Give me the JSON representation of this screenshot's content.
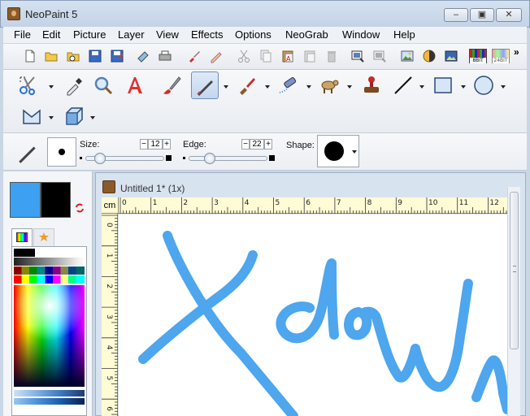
{
  "window": {
    "title": "NeoPaint 5",
    "min_glyph": "–",
    "max_glyph": "▣",
    "close_glyph": "✕"
  },
  "menu": [
    "File",
    "Edit",
    "Picture",
    "Layer",
    "View",
    "Effects",
    "Options",
    "NeoGrab",
    "Window",
    "Help"
  ],
  "toolbar_icons": [
    "new-icon",
    "open-icon",
    "open-recent-icon",
    "save-icon",
    "save-as-icon",
    "scan-icon",
    "print-icon",
    "brush-preset-icon",
    "pencil-preset-icon",
    "cut-icon",
    "copy-icon",
    "paste-icon",
    "paste-special-icon",
    "delete-icon",
    "crop-icon",
    "resize-icon",
    "image-icon",
    "color-balance-icon",
    "invert-icon",
    "8bit-icon",
    "24bit-icon"
  ],
  "toolbar_labels": {
    "bit8": "8BIT",
    "bit24": "24BIT",
    "more": "»"
  },
  "tools": [
    "selection-scissors-tool",
    "eyedropper-tool",
    "magnifier-tool",
    "text-tool",
    "brush-tool",
    "pen-tool",
    "paint-brush-tool",
    "airbrush-tool",
    "stamp-animal-tool",
    "seal-stamp-tool",
    "line-tool",
    "rectangle-tool",
    "ellipse-tool",
    "polygon-tool",
    "cube-tool"
  ],
  "options": {
    "size_label": "Size:",
    "size_value": "12",
    "edge_label": "Edge:",
    "edge_value": "22",
    "shape_label": "Shape:",
    "minus": "−",
    "plus": "+",
    "size_level": 0.12,
    "edge_level": 0.22
  },
  "colors": {
    "primary": "#3da0f0",
    "secondary": "#000000",
    "stroke": "#4da6ee"
  },
  "document": {
    "title": "Untitled 1* (1x)",
    "ruler_unit": "cm",
    "h_ticks": [
      "0",
      "1",
      "2",
      "3",
      "4",
      "5",
      "6",
      "7",
      "8",
      "9",
      "10",
      "11",
      "12"
    ],
    "v_ticks": [
      "0",
      "1",
      "2",
      "3",
      "4",
      "5",
      "6"
    ]
  }
}
